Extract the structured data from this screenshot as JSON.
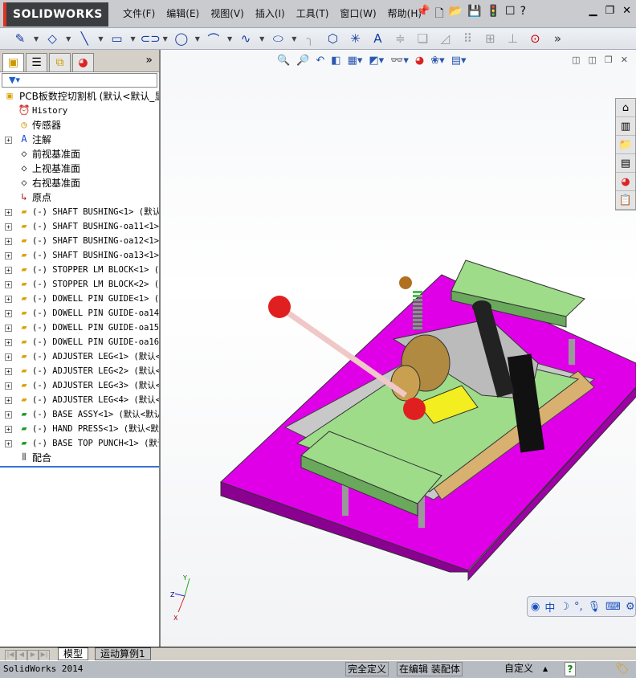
{
  "app": {
    "logo": "SOLIDWORKS"
  },
  "menu": [
    "文件(F)",
    "编辑(E)",
    "视图(V)",
    "插入(I)",
    "工具(T)",
    "窗口(W)",
    "帮助(H)"
  ],
  "help_icon": "?",
  "tree": {
    "filter_icon": "funnel-icon",
    "root": "PCB板数控切割机  (默认<默认_显",
    "items": [
      {
        "label": "History",
        "icon": "history-folder",
        "expand": false
      },
      {
        "label": "传感器",
        "icon": "sensor-folder",
        "expand": false
      },
      {
        "label": "注解",
        "icon": "annotation-folder",
        "expand": true
      },
      {
        "label": "前视基准面",
        "icon": "plane",
        "expand": false
      },
      {
        "label": "上视基准面",
        "icon": "plane",
        "expand": false
      },
      {
        "label": "右视基准面",
        "icon": "plane",
        "expand": false
      },
      {
        "label": "原点",
        "icon": "origin",
        "expand": false
      },
      {
        "label": "(-) SHAFT BUSHING<1> (默认<",
        "icon": "part",
        "expand": true
      },
      {
        "label": "(-) SHAFT BUSHING-oa11<1>",
        "icon": "part",
        "expand": true
      },
      {
        "label": "(-) SHAFT BUSHING-oa12<1>",
        "icon": "part",
        "expand": true
      },
      {
        "label": "(-) SHAFT BUSHING-oa13<1>",
        "icon": "part",
        "expand": true
      },
      {
        "label": "(-) STOPPER LM BLOCK<1> (",
        "icon": "part",
        "expand": true
      },
      {
        "label": "(-) STOPPER LM BLOCK<2> (",
        "icon": "part",
        "expand": true
      },
      {
        "label": "(-) DOWELL PIN GUIDE<1> (",
        "icon": "part",
        "expand": true
      },
      {
        "label": "(-) DOWELL PIN GUIDE-oa14<",
        "icon": "part",
        "expand": true
      },
      {
        "label": "(-) DOWELL PIN GUIDE-oa15<",
        "icon": "part",
        "expand": true
      },
      {
        "label": "(-) DOWELL PIN GUIDE-oa16<",
        "icon": "part",
        "expand": true
      },
      {
        "label": "(-) ADJUSTER LEG<1> (默认<",
        "icon": "part",
        "expand": true
      },
      {
        "label": "(-) ADJUSTER LEG<2> (默认<",
        "icon": "part",
        "expand": true
      },
      {
        "label": "(-) ADJUSTER LEG<3> (默认<",
        "icon": "part",
        "expand": true
      },
      {
        "label": "(-) ADJUSTER LEG<4> (默认<",
        "icon": "part",
        "expand": true
      },
      {
        "label": "(-) BASE ASSY<1> (默认<默认",
        "icon": "assembly",
        "expand": true
      },
      {
        "label": "(-) HAND PRESS<1> (默认<默",
        "icon": "assembly",
        "expand": true
      },
      {
        "label": "(-) BASE TOP PUNCH<1> (默认",
        "icon": "assembly",
        "expand": true
      },
      {
        "label": "配合",
        "icon": "mates",
        "expand": false
      }
    ]
  },
  "triad": {
    "x": "X",
    "y": "Y",
    "z": "Z"
  },
  "ime": {
    "lang": "中"
  },
  "bottom_tabs": [
    "模型",
    "运动算例1"
  ],
  "status": {
    "app": "SolidWorks 2014",
    "definition": "完全定义",
    "mode": "在编辑 装配体",
    "units": "自定义",
    "help": "?"
  }
}
